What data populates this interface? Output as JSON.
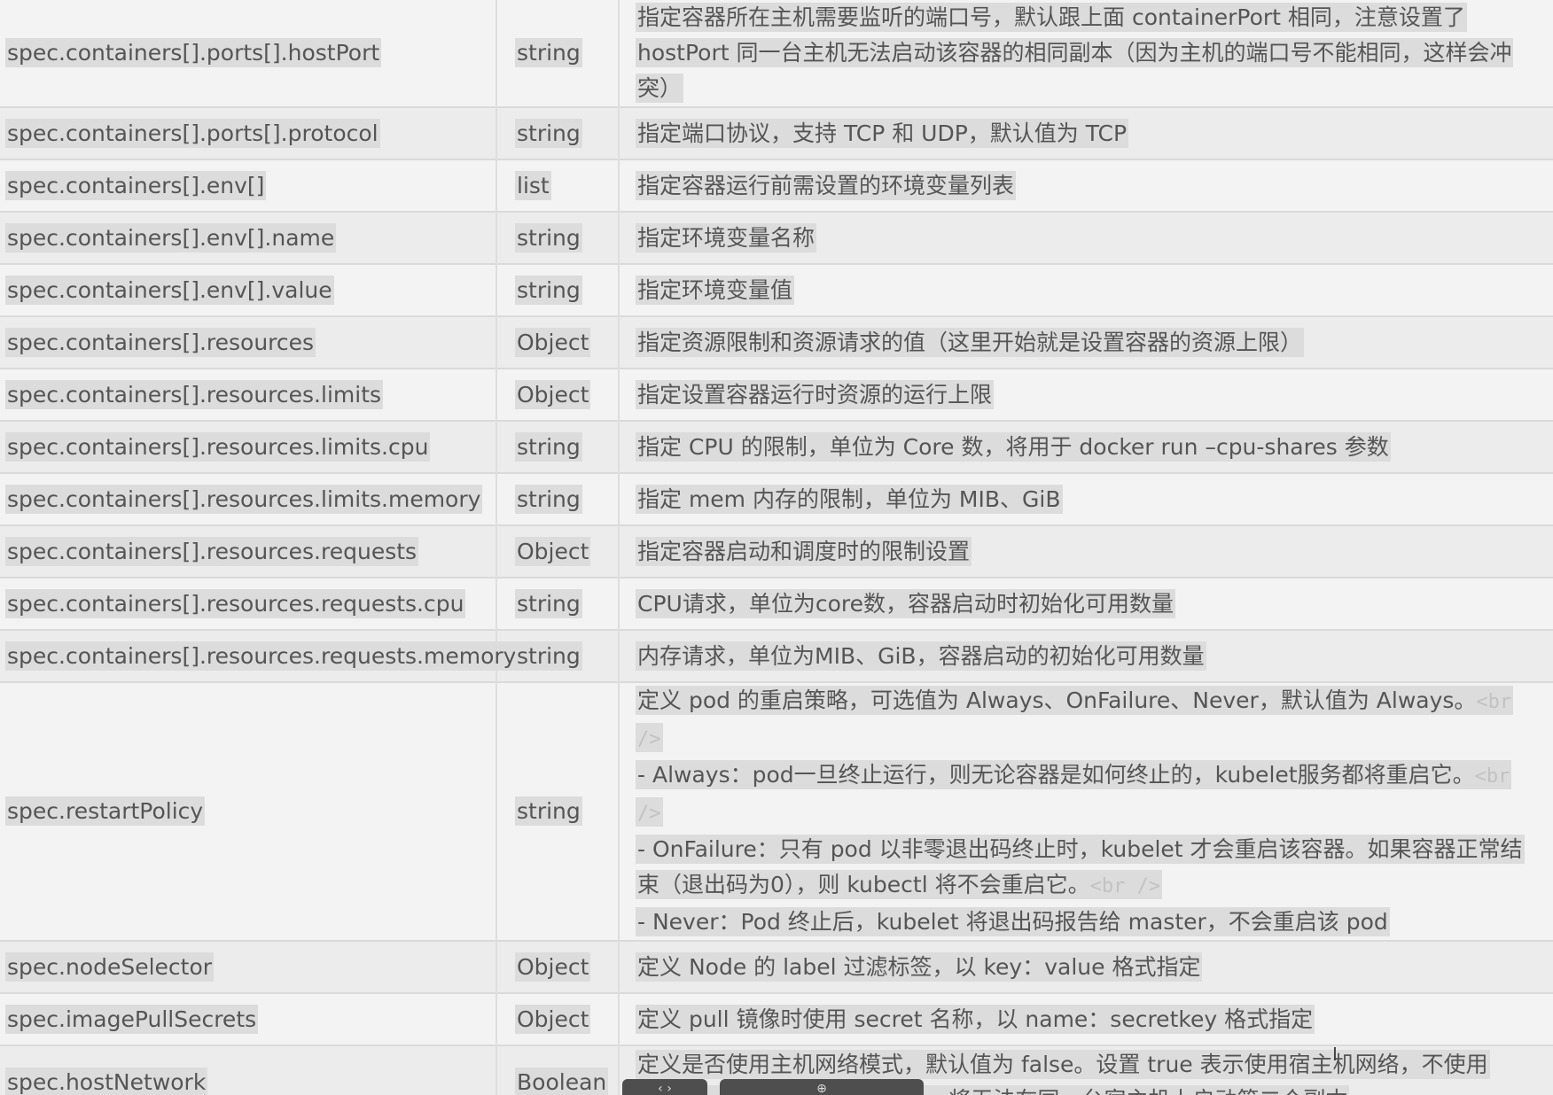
{
  "rows": [
    {
      "name": "spec.containers[].ports[].hostPort",
      "type": "string",
      "desc": [
        "指定容器所在主机需要监听的端口号，默认跟上面 containerPort 相同，注意设置了 hostPort 同一台主机无法启动该容器的相同副本（因为主机的端口号不能相同，这样会冲突）"
      ]
    },
    {
      "name": "spec.containers[].ports[].protocol",
      "type": "string",
      "desc": [
        "指定端口协议，支持 TCP 和 UDP，默认值为 TCP"
      ]
    },
    {
      "name": "spec.containers[].env[]",
      "type": "list",
      "desc": [
        "指定容器运行前需设置的环境变量列表"
      ]
    },
    {
      "name": "spec.containers[].env[].name",
      "type": "string",
      "desc": [
        "指定环境变量名称"
      ]
    },
    {
      "name": "spec.containers[].env[].value",
      "type": "string",
      "desc": [
        "指定环境变量值"
      ]
    },
    {
      "name": "spec.containers[].resources",
      "type": "Object",
      "desc": [
        "指定资源限制和资源请求的值（这里开始就是设置容器的资源上限）"
      ]
    },
    {
      "name": "spec.containers[].resources.limits",
      "type": "Object",
      "desc": [
        "指定设置容器运行时资源的运行上限"
      ]
    },
    {
      "name": "spec.containers[].resources.limits.cpu",
      "type": "string",
      "desc": [
        "指定 CPU 的限制，单位为 Core 数，将用于 docker run –cpu-shares 参数"
      ]
    },
    {
      "name": "spec.containers[].resources.limits.memory",
      "type": "string",
      "desc": [
        "指定 mem 内存的限制，单位为 MIB、GiB"
      ]
    },
    {
      "name": "spec.containers[].resources.requests",
      "type": "Object",
      "desc": [
        "指定容器启动和调度时的限制设置"
      ]
    },
    {
      "name": "spec.containers[].resources.requests.cpu",
      "type": "string",
      "desc": [
        "CPU请求，单位为core数，容器启动时初始化可用数量"
      ]
    },
    {
      "name": "spec.containers[].resources.requests.memory",
      "type": "string",
      "desc": [
        "内存请求，单位为MIB、GiB，容器启动的初始化可用数量"
      ]
    },
    {
      "name": "spec.restartPolicy",
      "type": "string",
      "desc": [
        "定义 pod 的重启策略，可选值为 Always、OnFailure、Never，默认值为 Always。<br />",
        " - Always：pod一旦终止运行，则无论容器是如何终止的，kubelet服务都将重启它。<br />",
        " - OnFailure：只有 pod 以非零退出码终止时，kubelet 才会重启该容器。如果容器正常结束（退出码为0），则 kubectl 将不会重启它。<br />",
        " - Never：Pod 终止后，kubelet 将退出码报告给 master，不会重启该 pod"
      ]
    },
    {
      "name": "spec.nodeSelector",
      "type": "Object",
      "desc": [
        "定义 Node 的 label 过滤标签，以 key：value 格式指定"
      ]
    },
    {
      "name": "spec.imagePullSecrets",
      "type": "Object",
      "desc": [
        "定义 pull 镜像时使用 secret 名称，以 name：secretkey 格式指定"
      ]
    },
    {
      "name": "spec.hostNetwork",
      "type": "Boolean",
      "desc": [
        "定义是否使用主机网络模式，默认值为 false。设置 true 表示使用宿主机网络，不使用 docker 网桥，同时设置了 true将无法在同一台宿主机上启动第二个副本"
      ]
    }
  ],
  "heights": [
    120,
    59,
    59,
    59,
    59,
    59,
    59,
    59,
    59,
    59,
    59,
    59,
    262,
    59,
    59,
    84
  ]
}
